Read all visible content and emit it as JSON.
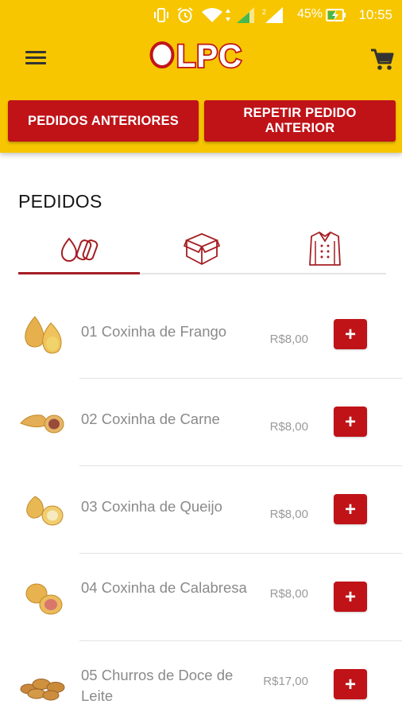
{
  "status_bar": {
    "battery_percent": "45%",
    "time": "10:55"
  },
  "header": {
    "logo_text": "LPC",
    "menu_icon": "hamburger-menu-icon",
    "cart_icon": "shopping-cart-icon",
    "previous_orders_label": "PEDIDOS ANTERIORES",
    "repeat_order_label": "REPETIR PEDIDO ANTERIOR"
  },
  "section_title": "PEDIDOS",
  "tabs": [
    {
      "icon": "snacks-icon",
      "active": true
    },
    {
      "icon": "box-icon",
      "active": false
    },
    {
      "icon": "chef-jacket-icon",
      "active": false
    }
  ],
  "colors": {
    "header_yellow": "#f7c600",
    "brand_red": "#bf1318",
    "tab_indicator": "#a51f24"
  },
  "products": [
    {
      "name": "01 Coxinha de Frango",
      "price": "R$8,00",
      "add_label": "+"
    },
    {
      "name": "02 Coxinha de Carne",
      "price": "R$8,00",
      "add_label": "+"
    },
    {
      "name": "03 Coxinha de Queijo",
      "price": "R$8,00",
      "add_label": "+"
    },
    {
      "name": "04 Coxinha de Calabresa",
      "price": "R$8,00",
      "add_label": "+"
    },
    {
      "name": "05 Churros de Doce de Leite",
      "price": "R$17,00",
      "add_label": "+"
    }
  ]
}
